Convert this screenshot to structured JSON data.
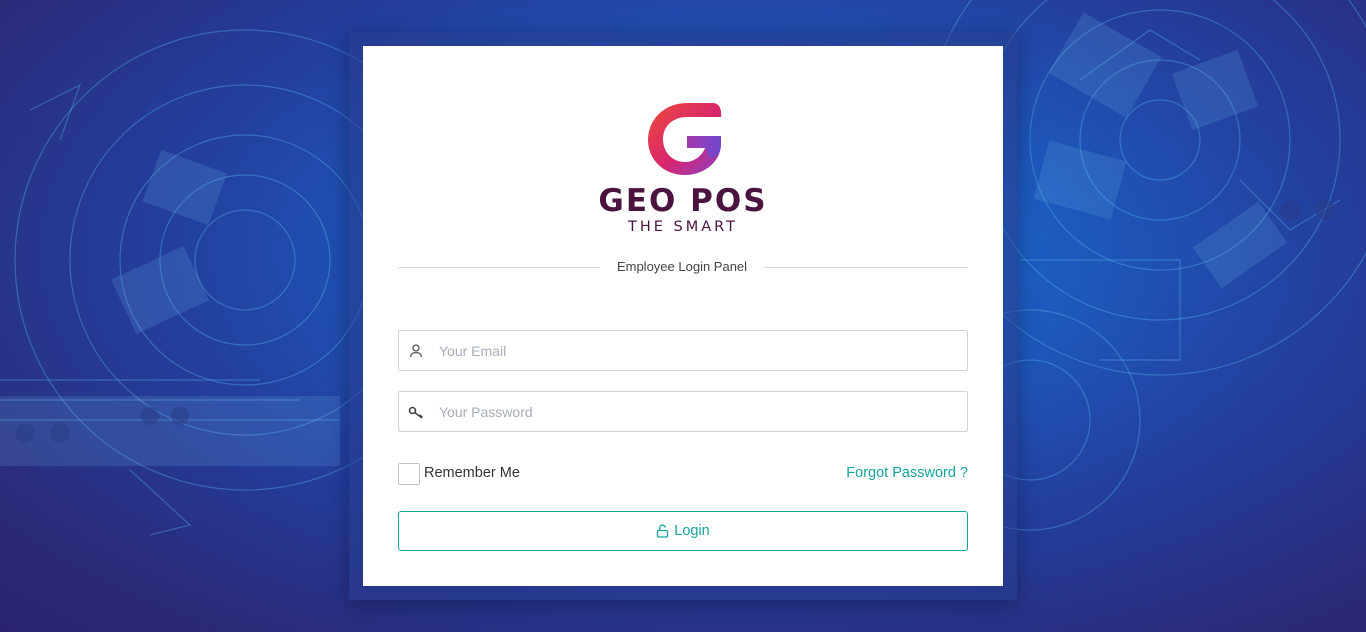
{
  "brand": {
    "name": "GEO POS",
    "tagline": "THE SMART",
    "colors": {
      "text": "#4a1340",
      "gradient_start": "#f04a3a",
      "gradient_end": "#8a3fc8"
    }
  },
  "panel": {
    "title": "Employee Login Panel"
  },
  "form": {
    "email": {
      "placeholder": "Your Email",
      "value": "",
      "icon": "user-icon"
    },
    "password": {
      "placeholder": "Your Password",
      "value": "",
      "icon": "key-icon"
    },
    "remember_label": "Remember Me",
    "remember_checked": false,
    "forgot_label": "Forgot Password ?",
    "login_label": "Login",
    "login_icon": "unlock-icon"
  },
  "colors": {
    "accent": "#18a39d",
    "background": "#233f9e"
  }
}
